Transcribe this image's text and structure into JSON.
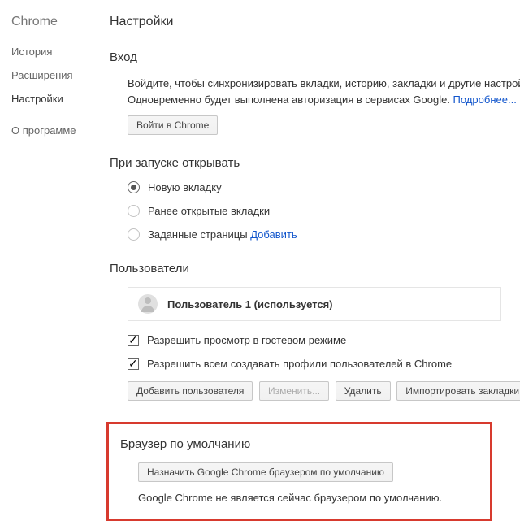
{
  "sidebar": {
    "title": "Chrome",
    "items": [
      {
        "label": "История",
        "active": false
      },
      {
        "label": "Расширения",
        "active": false
      },
      {
        "label": "Настройки",
        "active": true
      },
      {
        "label": "О программе",
        "active": false
      }
    ]
  },
  "page_title": "Настройки",
  "sections": {
    "signin": {
      "title": "Вход",
      "desc_part1": "Войдите, чтобы синхронизировать вкладки, историю, закладки и другие настройки на в",
      "desc_part2": "Одновременно будет выполнена авторизация в сервисах Google. ",
      "more_link": "Подробнее...",
      "button": "Войти в Chrome"
    },
    "startup": {
      "title": "При запуске открывать",
      "options": [
        {
          "label": "Новую вкладку",
          "selected": true
        },
        {
          "label": "Ранее открытые вкладки",
          "selected": false
        },
        {
          "label": "Заданные страницы",
          "selected": false,
          "link": "Добавить"
        }
      ]
    },
    "users": {
      "title": "Пользователи",
      "current_user": "Пользователь 1 (используется)",
      "check_guest": "Разрешить просмотр в гостевом режиме",
      "check_profiles": "Разрешить всем создавать профили пользователей в Chrome",
      "btn_add": "Добавить пользователя",
      "btn_edit": "Изменить...",
      "btn_delete": "Удалить",
      "btn_import": "Импортировать закладки и н"
    },
    "default_browser": {
      "title": "Браузер по умолчанию",
      "button": "Назначить Google Chrome браузером по умолчанию",
      "status": "Google Chrome не является сейчас браузером по умолчанию."
    }
  }
}
